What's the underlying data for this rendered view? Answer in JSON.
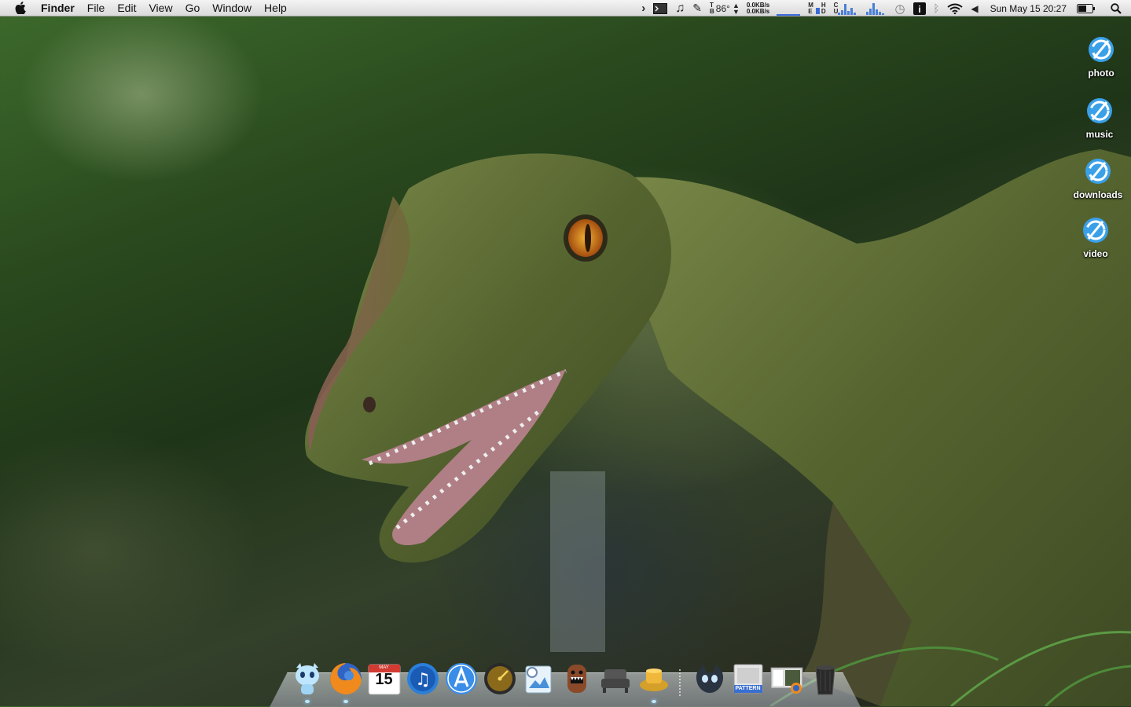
{
  "menubar": {
    "app_name": "Finder",
    "menus": [
      "File",
      "Edit",
      "View",
      "Go",
      "Window",
      "Help"
    ],
    "status": {
      "temperature": "86°",
      "net_up": "0.0KB/s",
      "net_down": "0.0KB/s",
      "clock": "Sun May 15  20:27"
    }
  },
  "desktop": {
    "icons": [
      {
        "label": "photo",
        "icon": "drive-icon"
      },
      {
        "label": "music",
        "icon": "drive-icon"
      },
      {
        "label": "downloads",
        "icon": "drive-icon"
      },
      {
        "label": "video",
        "icon": "drive-icon"
      }
    ]
  },
  "dock": {
    "items": [
      {
        "icon": "finder-icon",
        "running": true
      },
      {
        "icon": "firefox-icon",
        "running": true
      },
      {
        "icon": "calendar-icon",
        "running": false,
        "month": "MAY",
        "day": "15"
      },
      {
        "icon": "itunes-icon",
        "running": false
      },
      {
        "icon": "app-store-icon",
        "running": false
      },
      {
        "icon": "dashboard-icon",
        "running": false
      },
      {
        "icon": "preview-icon",
        "running": false
      },
      {
        "icon": "domo-icon",
        "running": false
      },
      {
        "icon": "chair-icon",
        "running": false
      },
      {
        "icon": "lamp-icon",
        "running": true
      },
      {
        "icon": "creature-icon",
        "running": false
      },
      {
        "icon": "pattern-icon",
        "running": false,
        "label": "PATTERN"
      },
      {
        "icon": "desktop-images-icon",
        "running": false
      },
      {
        "icon": "trash-icon",
        "running": false
      }
    ]
  },
  "colors": {
    "menubar_top": "#f4f4f4",
    "menubar_bottom": "#d9d9d9",
    "accent_blue": "#3a6ad8"
  }
}
